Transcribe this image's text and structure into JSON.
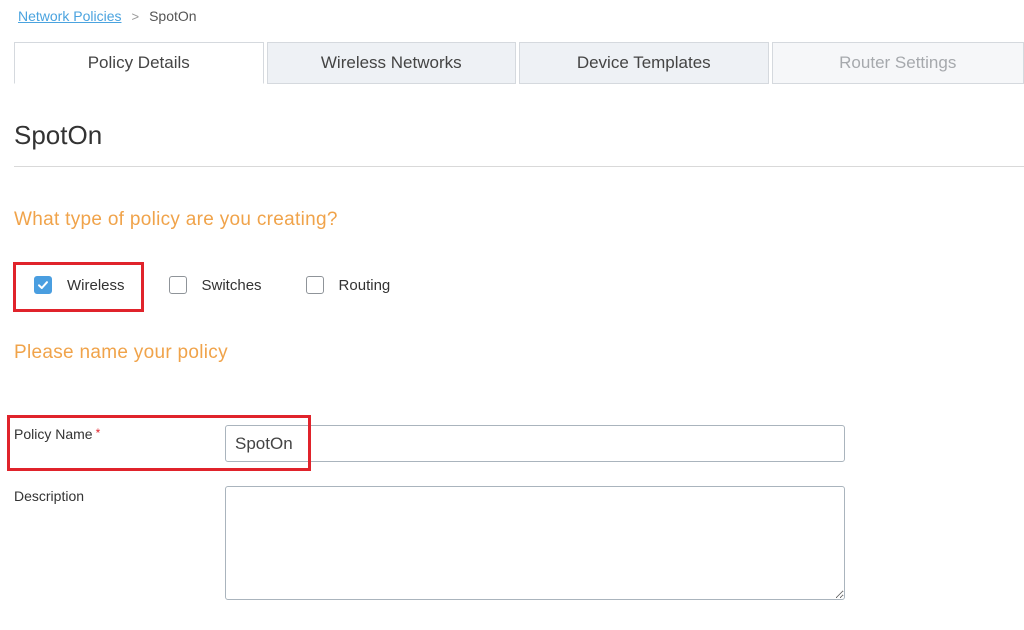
{
  "breadcrumb": {
    "parent": "Network Policies",
    "separator": ">",
    "current": "SpotOn"
  },
  "tabs": [
    {
      "label": "Policy Details",
      "state": "active"
    },
    {
      "label": "Wireless Networks",
      "state": "normal"
    },
    {
      "label": "Device Templates",
      "state": "normal"
    },
    {
      "label": "Router Settings",
      "state": "disabled"
    }
  ],
  "page_title": "SpotOn",
  "policy_type": {
    "heading": "What type of policy are you creating?",
    "options": [
      {
        "label": "Wireless",
        "checked": true
      },
      {
        "label": "Switches",
        "checked": false
      },
      {
        "label": "Routing",
        "checked": false
      }
    ]
  },
  "naming": {
    "heading": "Please name your policy",
    "policy_name_label": "Policy Name",
    "required_marker": "*",
    "policy_name_value": "SpotOn",
    "description_label": "Description",
    "description_value": ""
  },
  "colors": {
    "accent_orange": "#f0a34a",
    "checkbox_blue": "#4a9ee0",
    "highlight_red": "#e0232b",
    "link_blue": "#4aa3df"
  }
}
